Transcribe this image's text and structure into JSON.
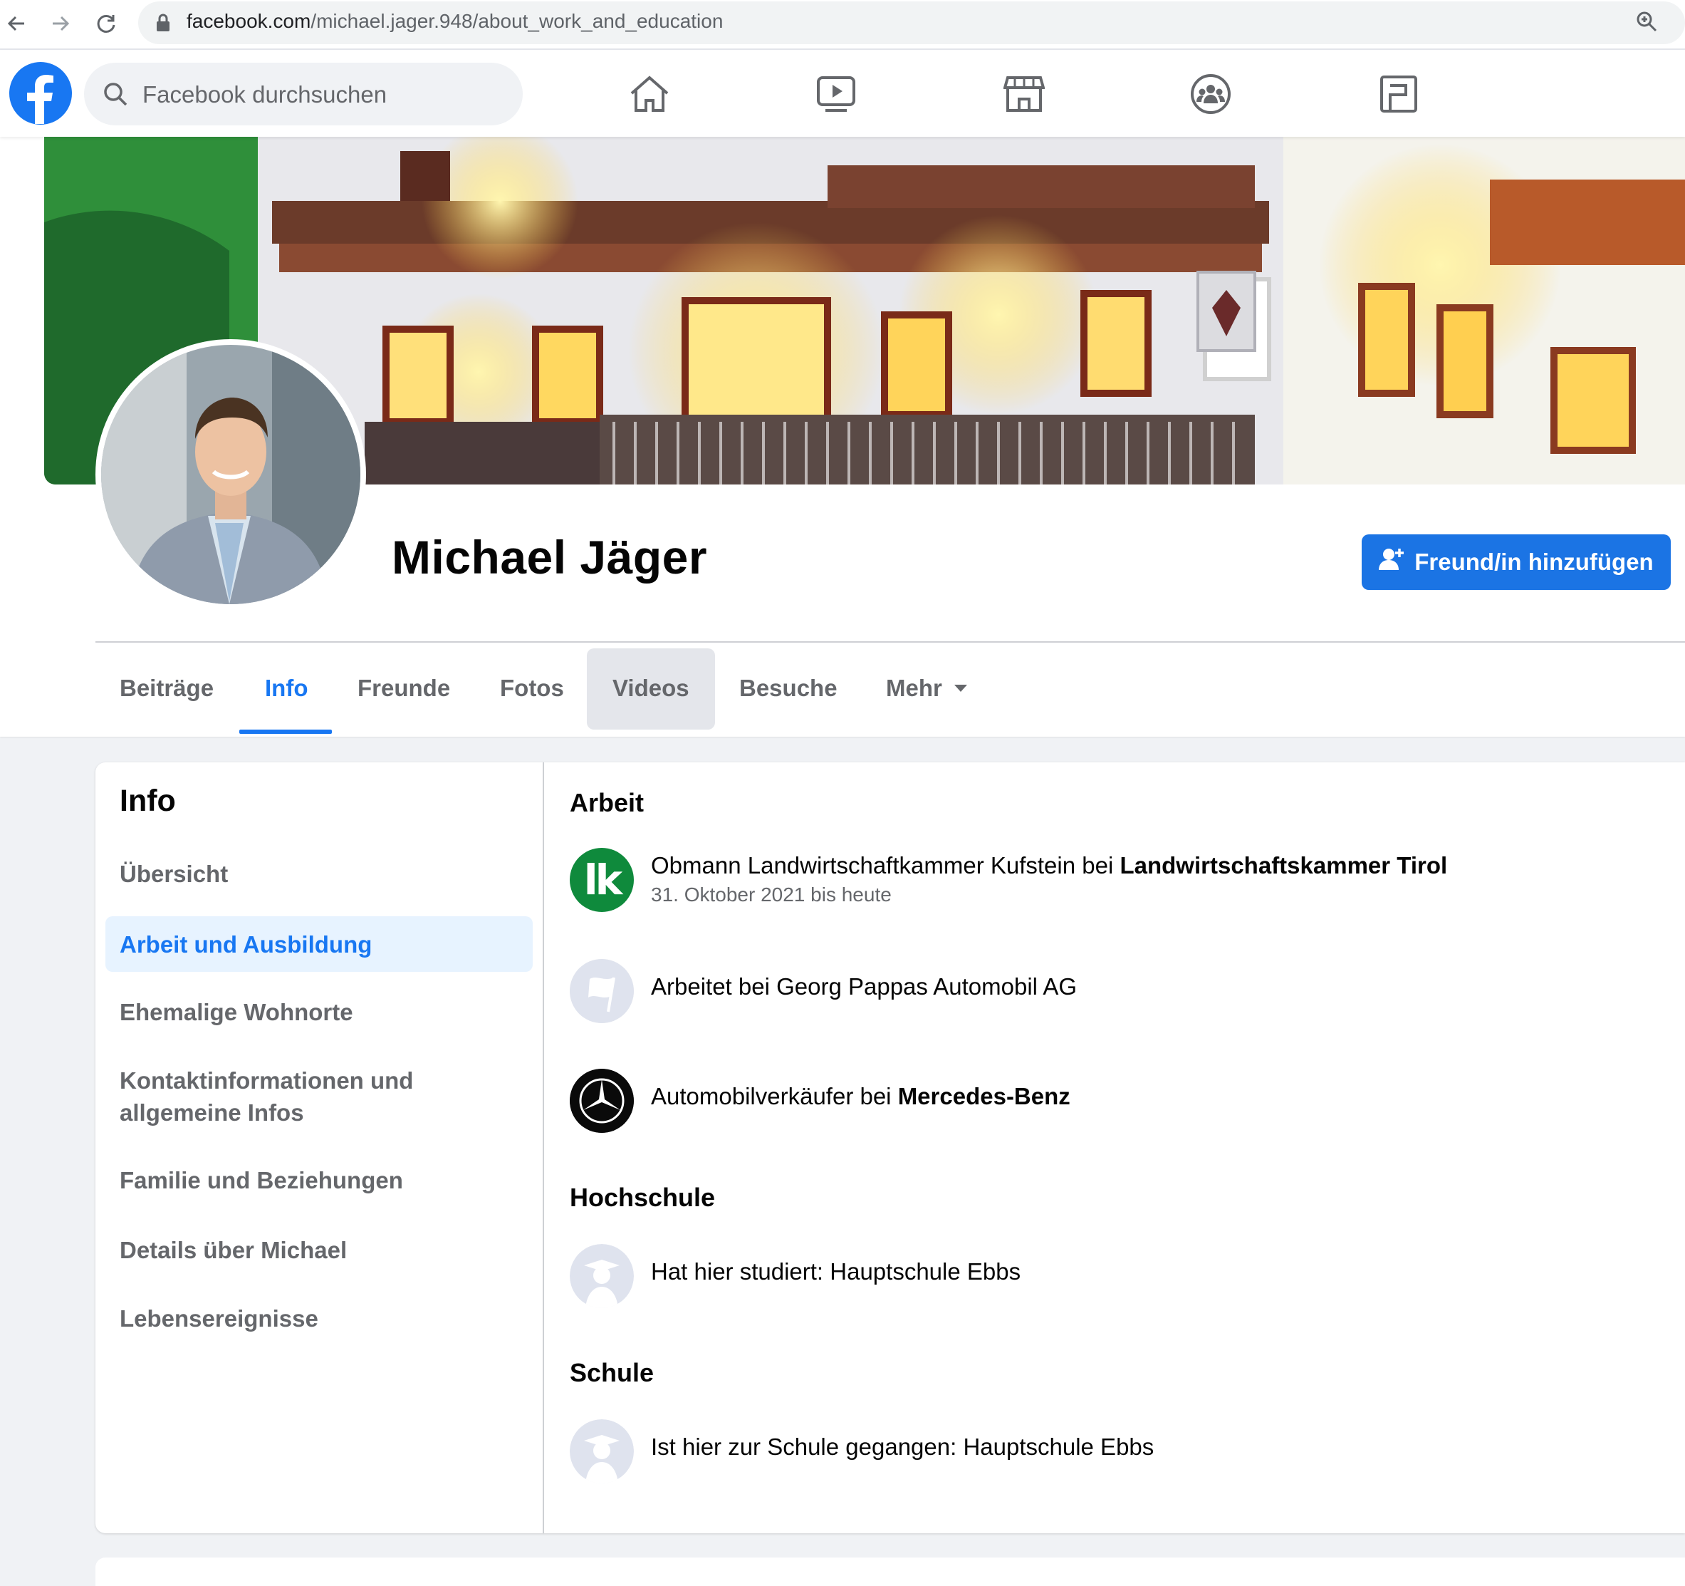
{
  "browser": {
    "url_domain": "facebook.com",
    "url_path": "/michael.jager.948/about_work_and_education"
  },
  "header": {
    "search_placeholder": "Facebook durchsuchen",
    "nav_icons": [
      "home-icon",
      "watch-icon",
      "marketplace-icon",
      "groups-icon",
      "gaming-icon"
    ]
  },
  "profile": {
    "name": "Michael Jäger",
    "add_friend_label": "Freund/in hinzufügen"
  },
  "tabs": [
    {
      "label": "Beiträge"
    },
    {
      "label": "Info"
    },
    {
      "label": "Freunde"
    },
    {
      "label": "Fotos"
    },
    {
      "label": "Videos"
    },
    {
      "label": "Besuche"
    },
    {
      "label": "Mehr"
    }
  ],
  "about": {
    "title": "Info",
    "items": [
      {
        "label": "Übersicht"
      },
      {
        "label": "Arbeit und Ausbildung"
      },
      {
        "label": "Ehemalige Wohnorte"
      },
      {
        "label": "Kontaktinformationen und allgemeine Infos"
      },
      {
        "label": "Familie und Beziehungen"
      },
      {
        "label": "Details über Michael"
      },
      {
        "label": "Lebensereignisse"
      }
    ]
  },
  "work": {
    "title": "Arbeit",
    "entries": [
      {
        "prefix": "Obmann Landwirtschaftkammer Kufstein bei ",
        "org": "Landwirtschaftskammer Tirol",
        "sub": "31. Oktober 2021 bis heute",
        "logo_text": "lk"
      },
      {
        "prefix": "Arbeitet bei Georg Pappas Automobil AG",
        "org": ""
      },
      {
        "prefix": "Automobilverkäufer bei ",
        "org": "Mercedes-Benz"
      }
    ]
  },
  "college": {
    "title": "Hochschule",
    "entry": "Hat hier studiert: Hauptschule Ebbs"
  },
  "school": {
    "title": "Schule",
    "entry": "Ist hier zur Schule gegangen: Hauptschule Ebbs"
  },
  "colors": {
    "accent": "#1877f2",
    "button": "#1b74e4",
    "text_secondary": "#65676b",
    "lk_green": "#0f8a3c"
  }
}
